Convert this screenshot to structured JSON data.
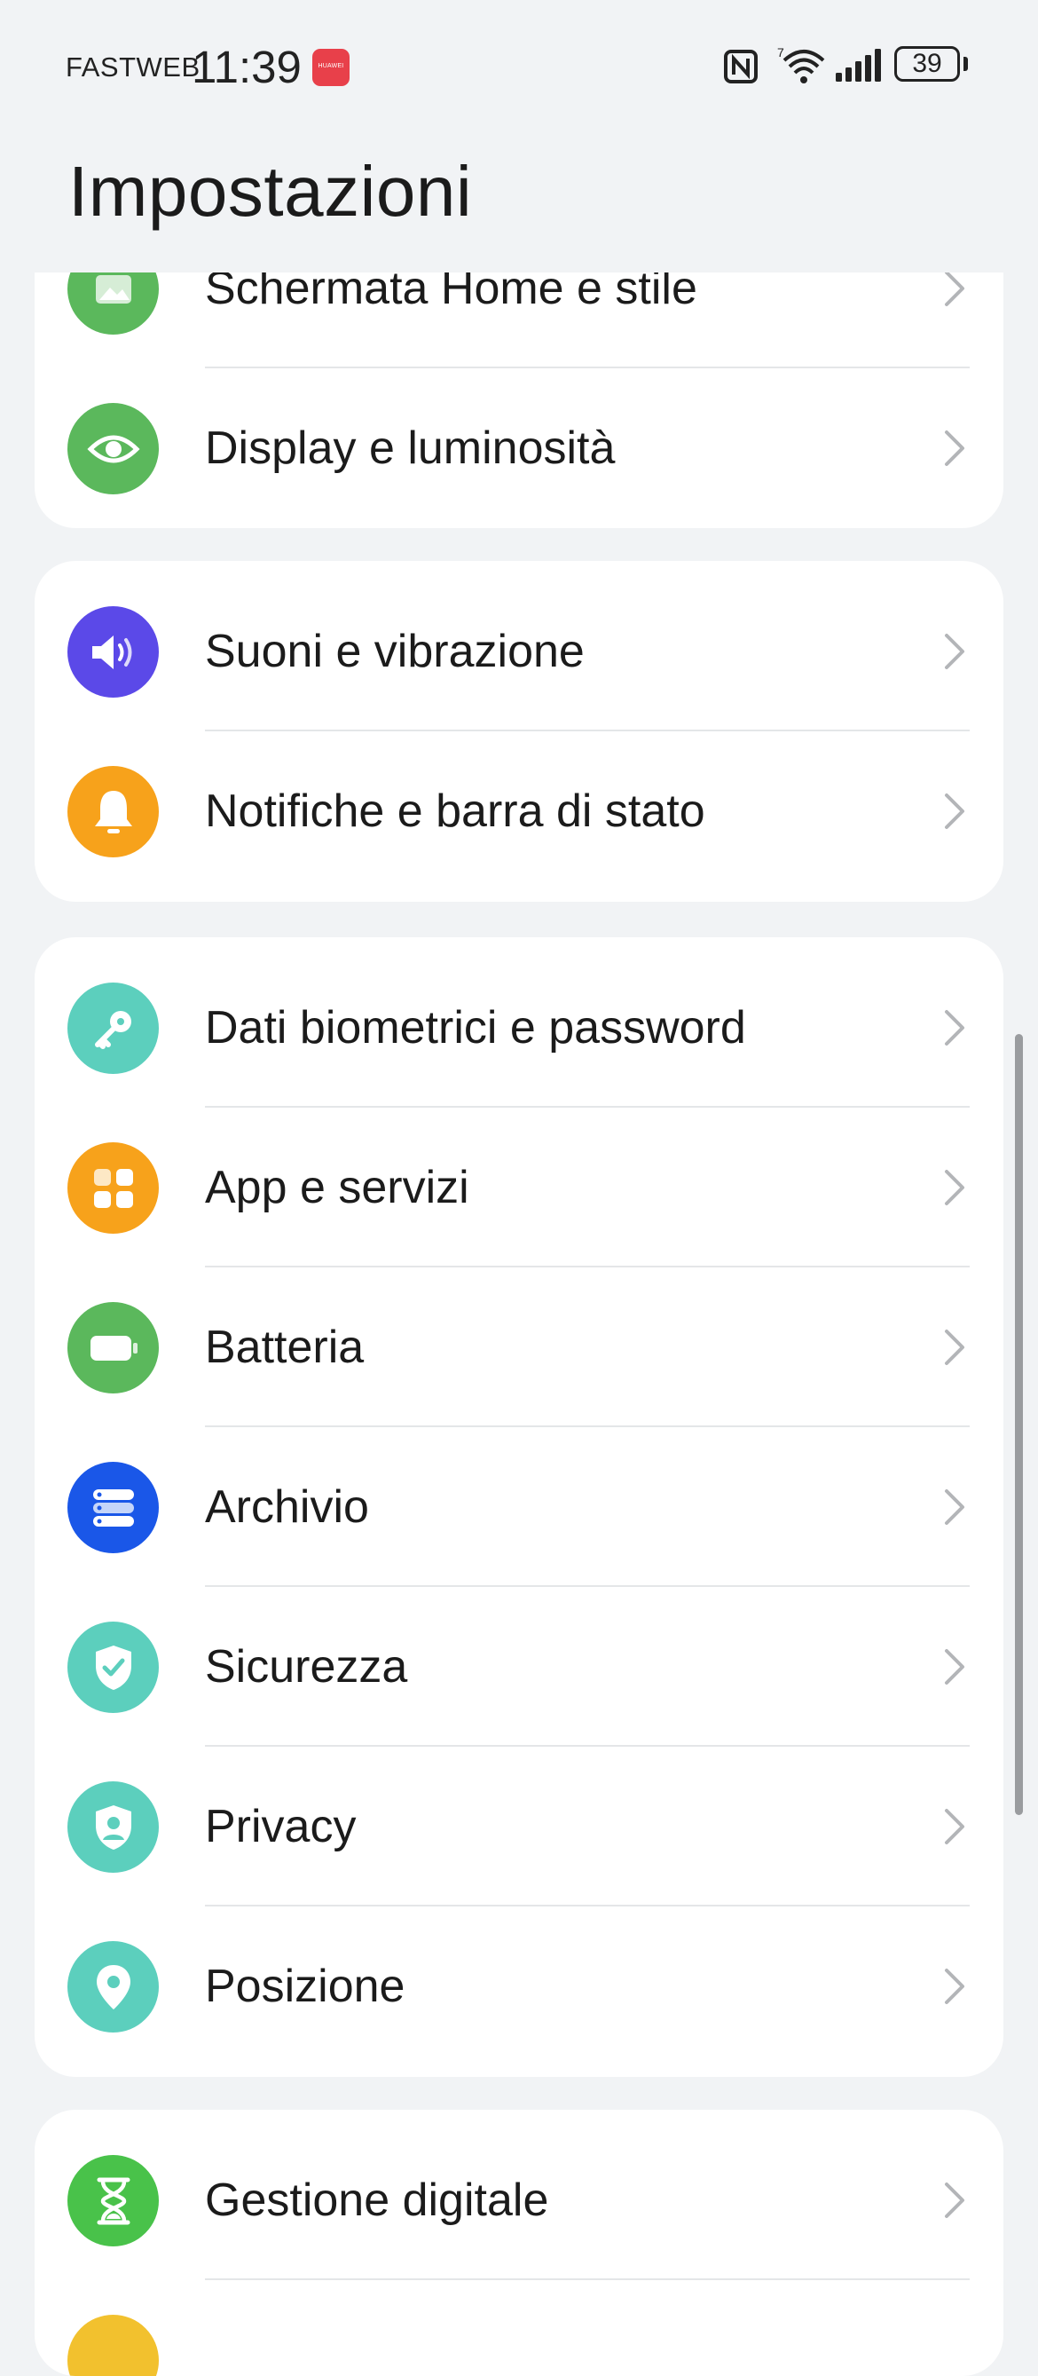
{
  "status_bar": {
    "carrier": "FASTWEB",
    "time": "11:39",
    "app_badge": "HUAWEI",
    "battery_level": "39"
  },
  "page": {
    "title": "Impostazioni"
  },
  "groups": [
    {
      "items": [
        {
          "label": "Schermata Home e stile",
          "icon": "image-icon",
          "color": "#5bb85c"
        },
        {
          "label": "Display e luminosità",
          "icon": "eye-icon",
          "color": "#5bb85c"
        }
      ]
    },
    {
      "items": [
        {
          "label": "Suoni e vibrazione",
          "icon": "speaker-icon",
          "color": "#5b49e8"
        },
        {
          "label": "Notifiche e barra di stato",
          "icon": "bell-icon",
          "color": "#f7a21b"
        }
      ]
    },
    {
      "items": [
        {
          "label": "Dati biometrici e password",
          "icon": "key-icon",
          "color": "#5ccfbd"
        },
        {
          "label": "App e servizi",
          "icon": "apps-grid-icon",
          "color": "#f7a21b"
        },
        {
          "label": "Batteria",
          "icon": "battery-icon",
          "color": "#5bb85c"
        },
        {
          "label": "Archivio",
          "icon": "storage-icon",
          "color": "#1a57e8"
        },
        {
          "label": "Sicurezza",
          "icon": "shield-check-icon",
          "color": "#5ccfbd"
        },
        {
          "label": "Privacy",
          "icon": "privacy-shield-icon",
          "color": "#5ccfbd"
        },
        {
          "label": "Posizione",
          "icon": "location-pin-icon",
          "color": "#5ccfbd"
        }
      ]
    },
    {
      "items": [
        {
          "label": "Gestione digitale",
          "icon": "hourglass-icon",
          "color": "#49c24a"
        }
      ]
    }
  ]
}
